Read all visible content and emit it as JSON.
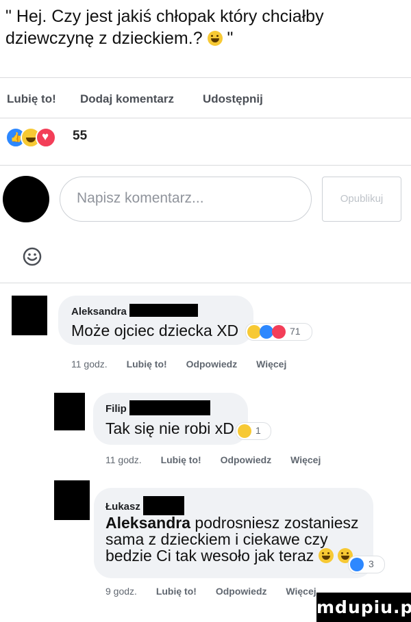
{
  "post": {
    "text": "\" Hej. Czy jest jakiś chłopak który chciałby dziewczynę z dzieckiem.? ",
    "text_end": " \"",
    "text_emoji": "grinning-face-emoji"
  },
  "actions": {
    "like": "Lubię to!",
    "comment": "Dodaj komentarz",
    "share": "Udostępnij"
  },
  "reactions": {
    "icons": [
      "like-icon",
      "haha-icon",
      "love-icon"
    ],
    "count": "55"
  },
  "composer": {
    "placeholder": "Napisz komentarz...",
    "publish_label": "Opublikuj",
    "emoji_icon": "smiley-icon"
  },
  "comments": [
    {
      "name": "Aleksandra",
      "text": "Może ojciec dziecka XD",
      "reaction_icons": [
        "haha-icon",
        "like-icon",
        "love-icon"
      ],
      "reaction_count": "71",
      "time": "11 godz.",
      "like": "Lubię to!",
      "reply": "Odpowiedz",
      "more": "Więcej"
    },
    {
      "name": "Filip",
      "text": "Tak się nie robi xD",
      "reaction_icons": [
        "haha-icon"
      ],
      "reaction_count": "1",
      "time": "11 godz.",
      "like": "Lubię to!",
      "reply": "Odpowiedz",
      "more": "Więcej"
    },
    {
      "name": "Łukasz",
      "tag": "Aleksandra",
      "text": " podrosniesz zostaniesz sama z dzieckiem i ciekawe czy bedzie Ci tak wesoło jak teraz",
      "reaction_icons": [
        "like-icon"
      ],
      "reaction_count": "3",
      "time": "9 godz.",
      "like": "Lubię to!",
      "reply": "Odpowiedz",
      "more": "Więcej"
    }
  ],
  "watermark": "mdupiu.pl",
  "colors": {
    "like": "#2d88ff",
    "love": "#f33e58",
    "haha": "#f7c934",
    "bubble": "#f0f2f5"
  }
}
